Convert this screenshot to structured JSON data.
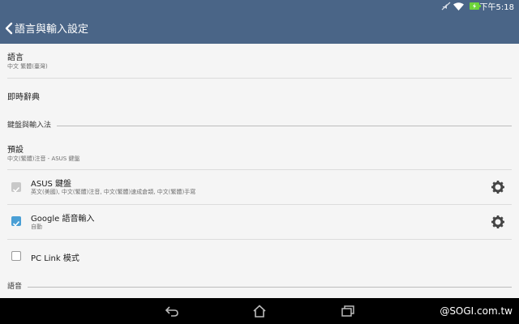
{
  "status_bar": {
    "time": "下午5:18",
    "icons": [
      "mute-icon",
      "wifi-icon",
      "battery-charging-icon"
    ]
  },
  "action_bar": {
    "title": "語言與輸入設定",
    "back_icon": "chevron-left-icon"
  },
  "settings": {
    "language": {
      "title": "語言",
      "summary": "中文 繁體(臺灣)"
    },
    "instant_dictionary": {
      "title": "即時辭典"
    },
    "keyboard_section": {
      "title": "鍵盤與輸入法"
    },
    "default": {
      "title": "預設",
      "summary": "中文(繁體)注音 - ASUS 鍵盤"
    },
    "asus_keyboard": {
      "title": "ASUS 鍵盤",
      "summary": "英文(美國), 中文(繁體)注音, 中文(繁體)速成倉頡, 中文(繁體)手寫",
      "checked": true,
      "enabled": false
    },
    "google_voice": {
      "title": "Google 語音輸入",
      "summary": "自動",
      "checked": true,
      "enabled": true
    },
    "pc_link": {
      "title": "PC Link 模式",
      "checked": false
    },
    "speech_section": {
      "title": "語音"
    }
  },
  "colors": {
    "bar": "#4a6587",
    "accent": "#4a9fd5",
    "disabled_check": "#c8c8c8"
  },
  "nav_bar": {
    "icons": [
      "back-icon",
      "home-icon",
      "recent-apps-icon"
    ]
  },
  "watermark": "@SOGI.com.tw"
}
